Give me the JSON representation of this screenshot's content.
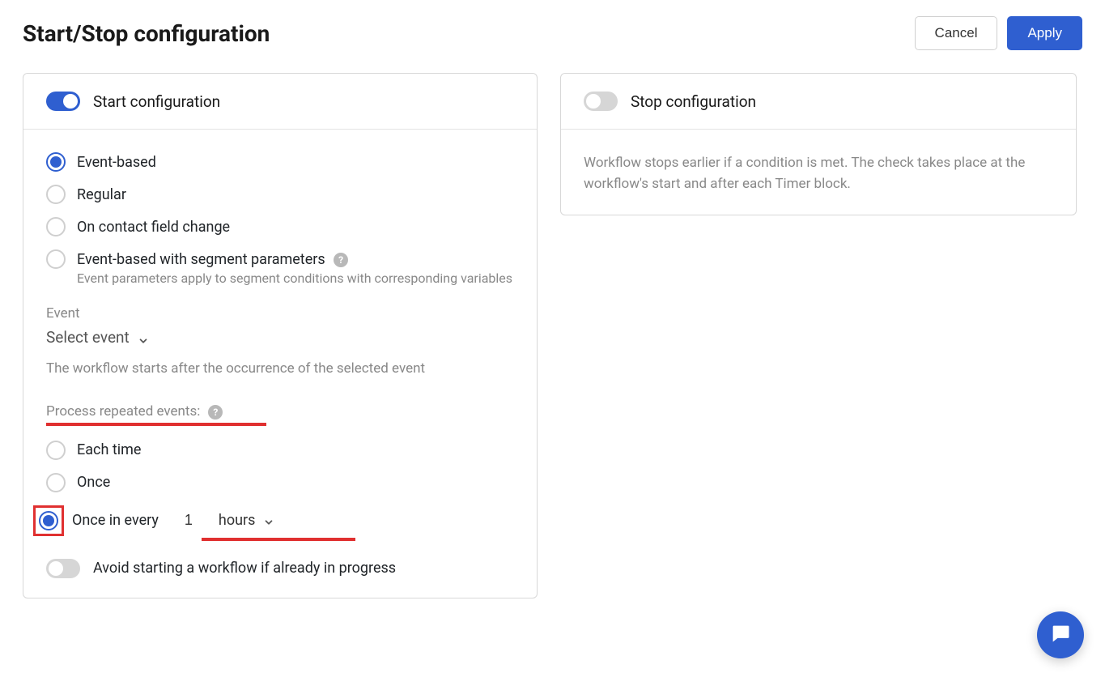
{
  "header": {
    "title": "Start/Stop configuration",
    "cancel": "Cancel",
    "apply": "Apply"
  },
  "start": {
    "title": "Start configuration",
    "toggled": true,
    "options": {
      "event_based": "Event-based",
      "regular": "Regular",
      "on_change": "On contact field change",
      "event_seg": "Event-based with segment parameters",
      "event_seg_help": "Event parameters apply to segment conditions with corresponding variables"
    },
    "event_label": "Event",
    "event_select": "Select event",
    "event_hint": "The workflow starts after the occurrence of the selected event",
    "repeat_label": "Process repeated events:",
    "repeat_options": {
      "each_time": "Each time",
      "once": "Once",
      "once_every": "Once in every"
    },
    "repeat_value": "1",
    "repeat_unit": "hours",
    "avoid_label": "Avoid starting a workflow if already in progress",
    "avoid_toggled": false
  },
  "stop": {
    "title": "Stop configuration",
    "toggled": false,
    "hint": "Workflow stops earlier if a condition is met. The check takes place at the workflow's start and after each Timer block."
  },
  "annotations": {
    "highlight_repeat_label": true,
    "highlight_repeat_input": true,
    "highlight_once_every_radio": true
  }
}
